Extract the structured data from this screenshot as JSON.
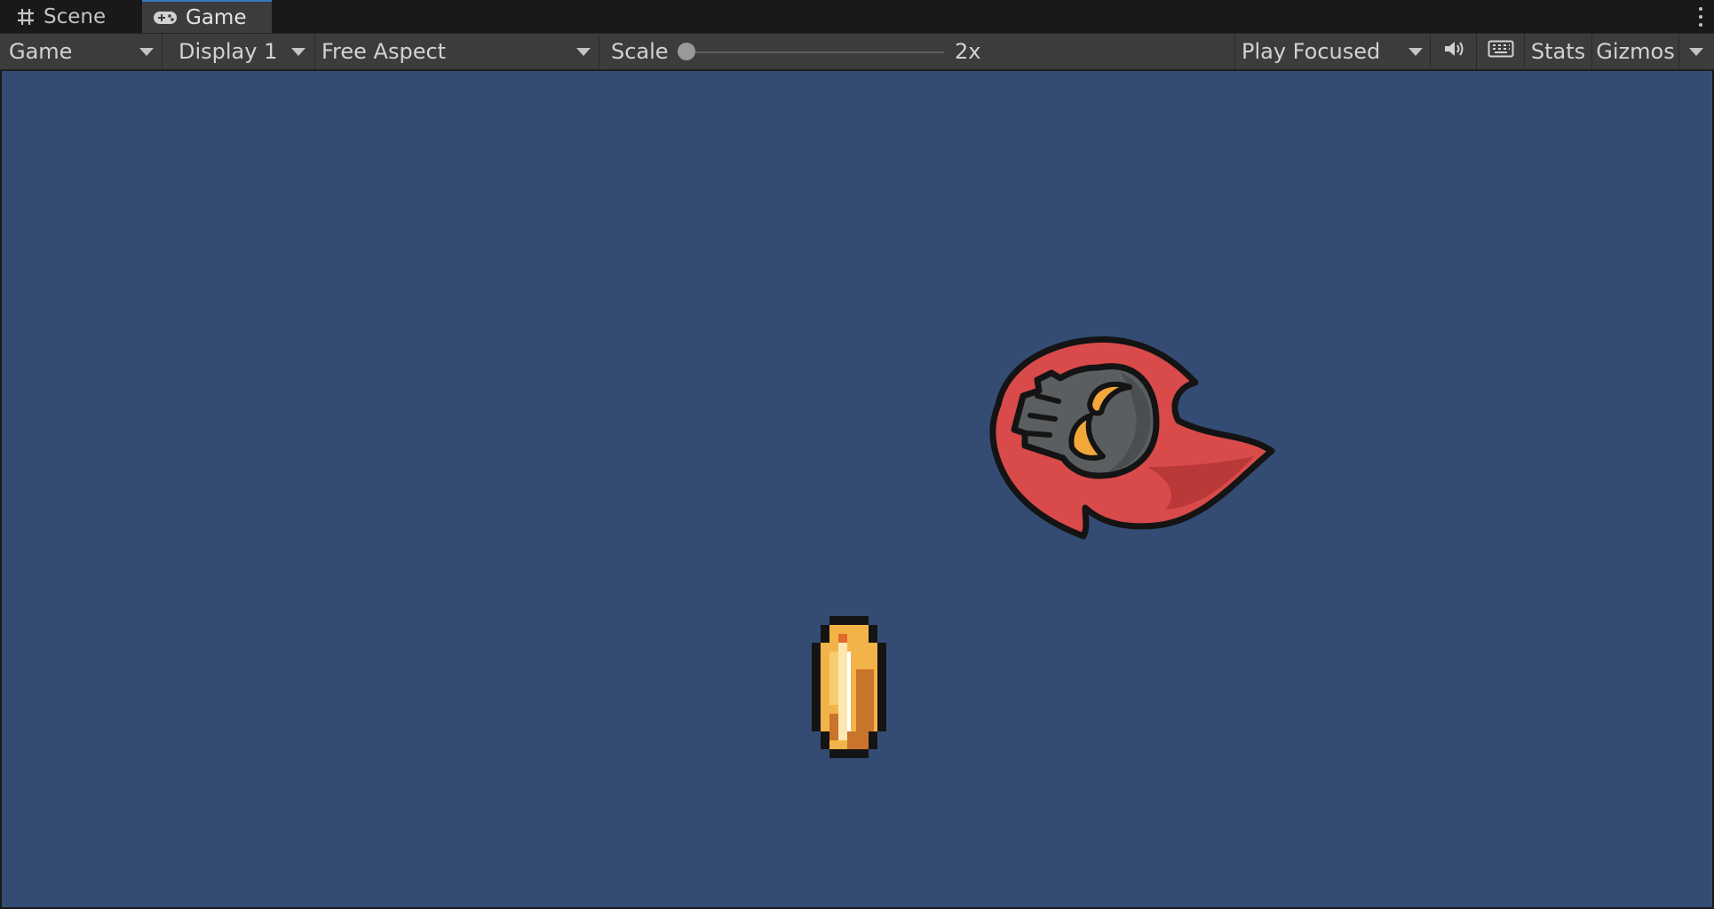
{
  "tabs": [
    {
      "label": "Scene",
      "icon": "grid-icon",
      "active": false
    },
    {
      "label": "Game",
      "icon": "gamepad-icon",
      "active": true
    }
  ],
  "toolbar": {
    "view_mode": "Game",
    "display": "Display 1",
    "aspect": "Free Aspect",
    "scale_label": "Scale",
    "scale_value": "2x",
    "scale_slider_fraction": 0.0,
    "play_mode": "Play Focused",
    "mute_icon": "speaker-icon",
    "keyboard_icon": "keyboard-icon",
    "stats_label": "Stats",
    "gizmos_label": "Gizmos"
  },
  "colors": {
    "editor_background": "#191919",
    "toolbar_background": "#3c3c3c",
    "game_background": "#344c73",
    "active_tab_accent": "#3a79bb",
    "fireball_red": "#d94a4a",
    "skull_gray": "#5a5e60",
    "coin_gold": "#f2b449"
  },
  "game_objects": [
    {
      "name": "flaming-skull-sprite"
    },
    {
      "name": "gold-coin-sprite"
    }
  ]
}
